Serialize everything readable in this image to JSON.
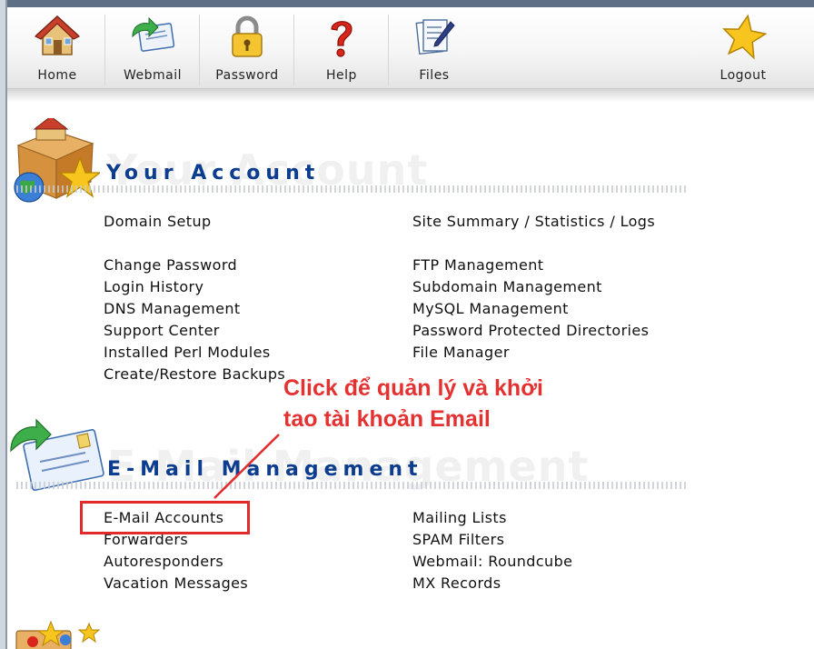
{
  "toolbar": {
    "items": [
      {
        "label": "Home",
        "icon": "home-icon"
      },
      {
        "label": "Webmail",
        "icon": "webmail-envelope-icon"
      },
      {
        "label": "Password",
        "icon": "padlock-icon"
      },
      {
        "label": "Help",
        "icon": "question-mark-icon"
      },
      {
        "label": "Files",
        "icon": "files-pen-icon"
      },
      {
        "label": "Logout",
        "icon": "star-icon"
      }
    ]
  },
  "your_account": {
    "title": "Your Account",
    "left_links": [
      "Domain Setup",
      "Change Password",
      "Login History",
      "DNS Management",
      "Support Center",
      "Installed Perl Modules",
      "Create/Restore Backups"
    ],
    "right_links": [
      "Site Summary / Statistics / Logs",
      "FTP Management",
      "Subdomain Management",
      "MySQL Management",
      "Password Protected Directories",
      "File Manager"
    ]
  },
  "email_management": {
    "title": "E-Mail Management",
    "left_links": [
      "E-Mail Accounts",
      "Forwarders",
      "Autoresponders",
      "Vacation Messages"
    ],
    "right_links": [
      "Mailing Lists",
      "SPAM Filters",
      "Webmail: Roundcube",
      "MX Records"
    ]
  },
  "annotation": {
    "line1": "Click để quản lý và khởi",
    "line2": "tao tài khoản Email",
    "color": "#e43131"
  },
  "colors": {
    "section_title": "#0d3d8f",
    "highlight_border": "#e32a2a"
  }
}
